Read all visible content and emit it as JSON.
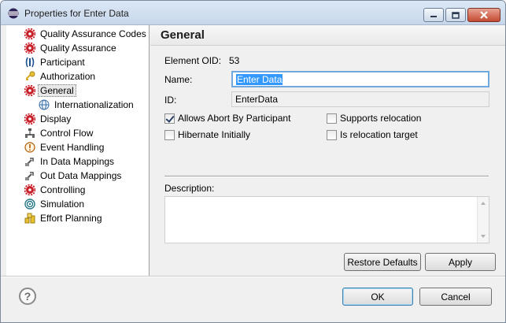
{
  "window": {
    "title": "Properties for Enter Data"
  },
  "tree": {
    "items": [
      {
        "label": "Quality Assurance Codes",
        "icon": "gear-red-icon",
        "indent": 0
      },
      {
        "label": "Quality Assurance",
        "icon": "gear-red-icon",
        "indent": 0
      },
      {
        "label": "Participant",
        "icon": "participant-icon",
        "indent": 0
      },
      {
        "label": "Authorization",
        "icon": "key-icon",
        "indent": 0
      },
      {
        "label": "General",
        "icon": "gear-red-icon",
        "indent": 0,
        "selected": true
      },
      {
        "label": "Internationalization",
        "icon": "globe-icon",
        "indent": 1
      },
      {
        "label": "Display",
        "icon": "gear-red-icon",
        "indent": 0
      },
      {
        "label": "Control Flow",
        "icon": "control-flow-icon",
        "indent": 0
      },
      {
        "label": "Event Handling",
        "icon": "event-icon",
        "indent": 0
      },
      {
        "label": "In Data Mappings",
        "icon": "in-data-mapping-icon",
        "indent": 0
      },
      {
        "label": "Out Data Mappings",
        "icon": "out-data-mapping-icon",
        "indent": 0
      },
      {
        "label": "Controlling",
        "icon": "gear-red-icon",
        "indent": 0
      },
      {
        "label": "Simulation",
        "icon": "simulation-icon",
        "indent": 0
      },
      {
        "label": "Effort Planning",
        "icon": "effort-planning-icon",
        "indent": 0
      }
    ]
  },
  "general": {
    "title": "General",
    "element_oid_label": "Element OID:",
    "element_oid_value": "53",
    "name_label": "Name:",
    "name_value": "Enter Data",
    "id_label": "ID:",
    "id_value": "EnterData",
    "allows_abort_label": "Allows Abort By Participant",
    "allows_abort_checked": true,
    "supports_relocation_label": "Supports relocation",
    "supports_relocation_checked": false,
    "hibernate_label": "Hibernate Initially",
    "hibernate_checked": false,
    "relocation_target_label": "Is relocation target",
    "relocation_target_checked": false,
    "description_label": "Description:",
    "description_value": ""
  },
  "buttons": {
    "restore_defaults": "Restore Defaults",
    "apply": "Apply",
    "ok": "OK",
    "cancel": "Cancel",
    "help": "?"
  },
  "colors": {
    "gear_red": "#c8202a",
    "selection_blue": "#3399ff",
    "focus_border": "#6fa9e0"
  }
}
